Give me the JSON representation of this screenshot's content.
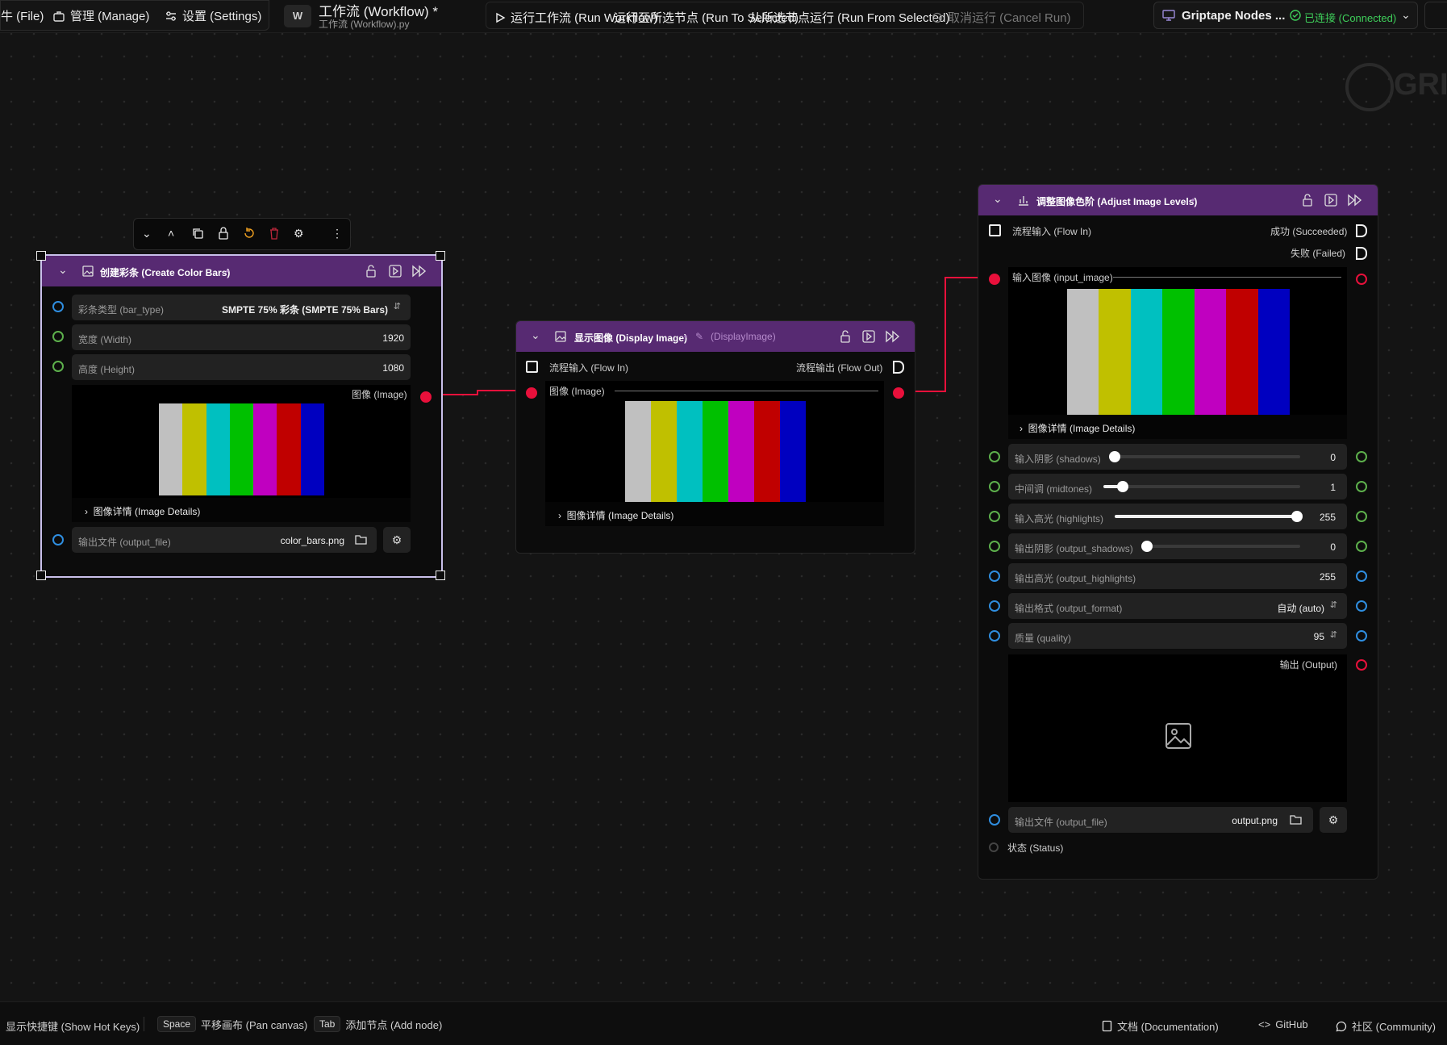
{
  "topbar": {
    "menu": [
      {
        "label": "牛 (File)",
        "icon": "none"
      },
      {
        "label": "管理 (Manage)",
        "icon": "briefcase-icon"
      },
      {
        "label": "设置 (Settings)",
        "icon": "sliders-icon"
      }
    ],
    "workflow_badge": "W",
    "workflow_title": "工作流 (Workflow) *",
    "workflow_file": "工作流 (Workflow).py",
    "run_workflow": "运行工作流 (Run Workflow)",
    "run_to_selected": "运行至所选节点 (Run To Selected)",
    "run_from_selected": "从所选节点运行 (Run From Selected)",
    "cancel_run": "取消运行 (Cancel Run)",
    "connection_name": "Griptape Nodes ...",
    "connection_status": "已连接 (Connected)"
  },
  "watermark": "GRI",
  "bottombar": {
    "show_hotkeys": "显示快捷键 (Show Hot Keys)",
    "space_key": "Space",
    "pan_canvas": "平移画布 (Pan canvas)",
    "tab_key": "Tab",
    "add_node": "添加节点 (Add node)",
    "documentation": "文档 (Documentation)",
    "github": "GitHub",
    "community": "社区 (Community)"
  },
  "colors": {
    "node_header": "#572a72",
    "connection": "#e8103b",
    "connected_green": "#3ecf5a",
    "color_bars": [
      "#c0c0c0",
      "#c0c000",
      "#00c0c0",
      "#00c000",
      "#c000c0",
      "#c00000",
      "#0000c0"
    ]
  },
  "node_create": {
    "title": "创建彩条 (Create Color Bars)",
    "dot": "•",
    "bar_type_label": "彩条类型 (bar_type)",
    "bar_type_value": "SMPTE 75% 彩条 (SMPTE 75% Bars)",
    "width_label": "宽度 (Width)",
    "width_value": "1920",
    "height_label": "高度 (Height)",
    "height_value": "1080",
    "image_label": "图像 (Image)",
    "image_details": "图像详情 (Image Details)",
    "output_file_label": "输出文件 (output_file)",
    "output_file_value": "color_bars.png"
  },
  "node_display": {
    "title": "显示图像 (Display Image)",
    "dot": "•",
    "subtitle": "(DisplayImage)",
    "flow_in": "流程输入 (Flow In)",
    "flow_out": "流程输出 (Flow Out)",
    "image_label": "图像 (Image)",
    "image_details": "图像详情 (Image Details)"
  },
  "node_adjust": {
    "title": "调整图像色阶 (Adjust Image Levels)",
    "dot": "•",
    "flow_in": "流程输入 (Flow In)",
    "succeeded": "成功 (Succeeded)",
    "failed": "失败 (Failed)",
    "input_image_label": "输入图像 (input_image)",
    "image_details": "图像详情 (Image Details)",
    "shadows_label": "输入阴影 (shadows)",
    "shadows_value": "0",
    "shadows_fraction": 0,
    "midtones_label": "中间调 (midtones)",
    "midtones_value": "1",
    "midtones_fraction": 0.1,
    "highlights_label": "输入高光 (highlights)",
    "highlights_value": "255",
    "highlights_fraction": 1,
    "output_shadows_label": "输出阴影 (output_shadows)",
    "output_shadows_value": "0",
    "output_shadows_fraction": 0,
    "output_highlights_label": "输出高光 (output_highlights)",
    "output_highlights_value": "255",
    "output_format_label": "输出格式 (output_format)",
    "output_format_value": "自动 (auto)",
    "quality_label": "质量 (quality)",
    "quality_value": "95",
    "output_label": "输出 (Output)",
    "output_file_label": "输出文件 (output_file)",
    "output_file_value": "output.png",
    "status_label": "状态 (Status)"
  }
}
